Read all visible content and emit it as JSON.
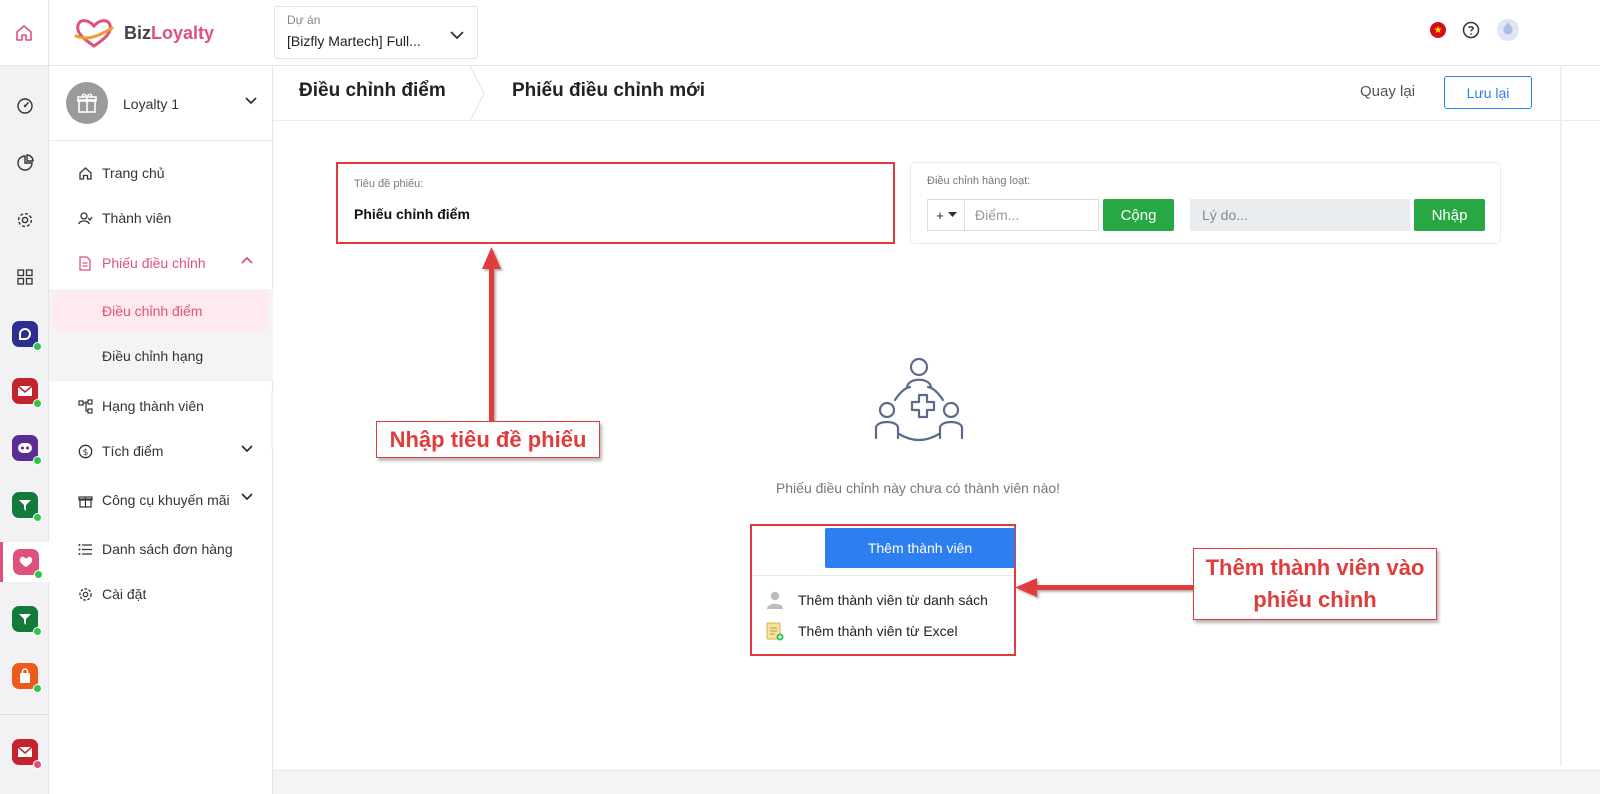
{
  "header": {
    "logo_text_part1": "Biz",
    "logo_text_part2": "Loyalty",
    "project_label": "Dự án",
    "project_value": "[Bizfly Martech] Full...",
    "icons": [
      "home-icon",
      "vietnam-flag-icon",
      "help-icon",
      "user-avatar-icon"
    ]
  },
  "rail": {
    "icons": [
      "dashboard-icon",
      "report-icon",
      "settings-icon",
      "apps-grid-icon",
      "bizfly-chat-app",
      "bizfly-mail-app",
      "bizfly-bot-app",
      "bizfly-crm-app",
      "bizloyalty-app",
      "bizfly-crm-app-2",
      "bizfly-shop-app",
      "bizfly-mail-add-app"
    ]
  },
  "sidebar": {
    "account_name": "Loyalty 1",
    "items": [
      {
        "label": "Trang chủ",
        "icon": "home-icon"
      },
      {
        "label": "Thành viên",
        "icon": "member-icon"
      },
      {
        "label": "Phiếu điều chỉnh",
        "icon": "document-icon"
      },
      {
        "label": "Hạng thành viên",
        "icon": "tier-icon"
      },
      {
        "label": "Tích điểm",
        "icon": "coin-icon"
      },
      {
        "label": "Công cụ khuyến mãi",
        "icon": "gift-icon"
      },
      {
        "label": "Danh sách đơn hàng",
        "icon": "list-icon"
      },
      {
        "label": "Cài đặt",
        "icon": "gear-icon"
      }
    ],
    "subitems": [
      {
        "label": "Điều chỉnh điểm"
      },
      {
        "label": "Điều chỉnh hạng"
      }
    ]
  },
  "breadcrumb": {
    "item1": "Điều chỉnh điểm",
    "item2": "Phiếu điều chỉnh mới"
  },
  "actions": {
    "back_label": "Quay lại",
    "save_label": "Lưu lại"
  },
  "form": {
    "title_label": "Tiêu đề phiếu:",
    "title_value": "Phiếu chỉnh điểm",
    "batch_label": "Điều chỉnh hàng loạt:",
    "sign_value": "+",
    "points_placeholder": "Điểm...",
    "add_label": "Cộng",
    "reason_placeholder": "Lý do...",
    "import_label": "Nhập"
  },
  "empty_state": {
    "message": "Phiếu điều chỉnh này chưa có thành viên nào!"
  },
  "add_member": {
    "button_label": "Thêm thành viên",
    "option_list": "Thêm thành viên từ danh sách",
    "option_excel": "Thêm thành viên từ Excel"
  },
  "annotations": {
    "callout_title": "Nhập tiêu đề phiếu",
    "callout_add_line1": "Thêm thành viên vào",
    "callout_add_line2": "phiếu chỉnh"
  },
  "colors": {
    "brand_pink": "#e0517a",
    "primary_blue": "#2d7ff0",
    "success_green": "#27a845",
    "annotation_red": "#e03c3c"
  }
}
